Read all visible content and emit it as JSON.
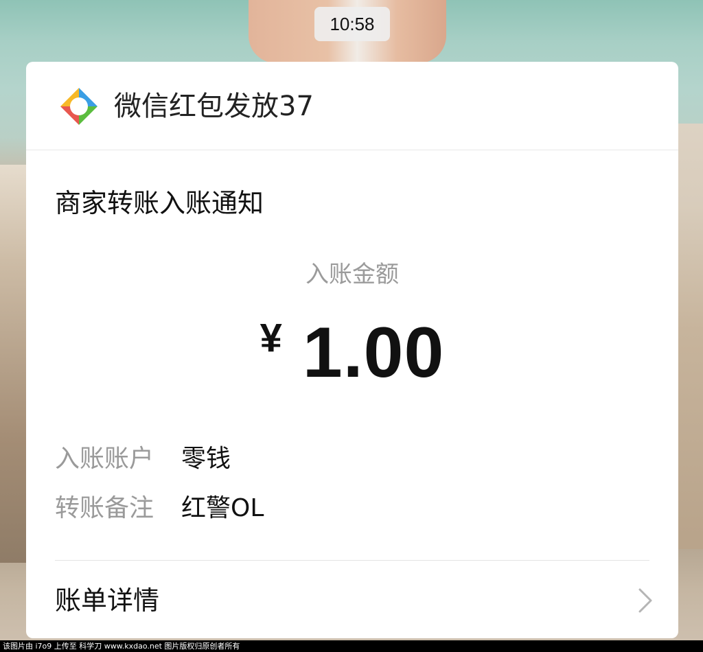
{
  "status_bar": {
    "time": "10:58"
  },
  "card": {
    "app": {
      "name": "微信红包发放37",
      "logo_icon": "four-color-diamond-logo",
      "logo_colors": [
        "#e8574f",
        "#f7b928",
        "#3a9ee4",
        "#5bbd3e"
      ]
    },
    "notice_title": "商家转账入账通知",
    "amount": {
      "label": "入账金额",
      "currency": "¥",
      "value": "1.00"
    },
    "info_rows": [
      {
        "key": "入账账户",
        "value": "零钱"
      },
      {
        "key": "转账备注",
        "value": "红警OL"
      }
    ],
    "detail": {
      "label": "账单详情",
      "icon": "chevron-right-icon"
    }
  },
  "watermark": {
    "text": "该图片由 i7o9 上传至 科学刀 www.kxdao.net 图片版权归原创者所有"
  }
}
